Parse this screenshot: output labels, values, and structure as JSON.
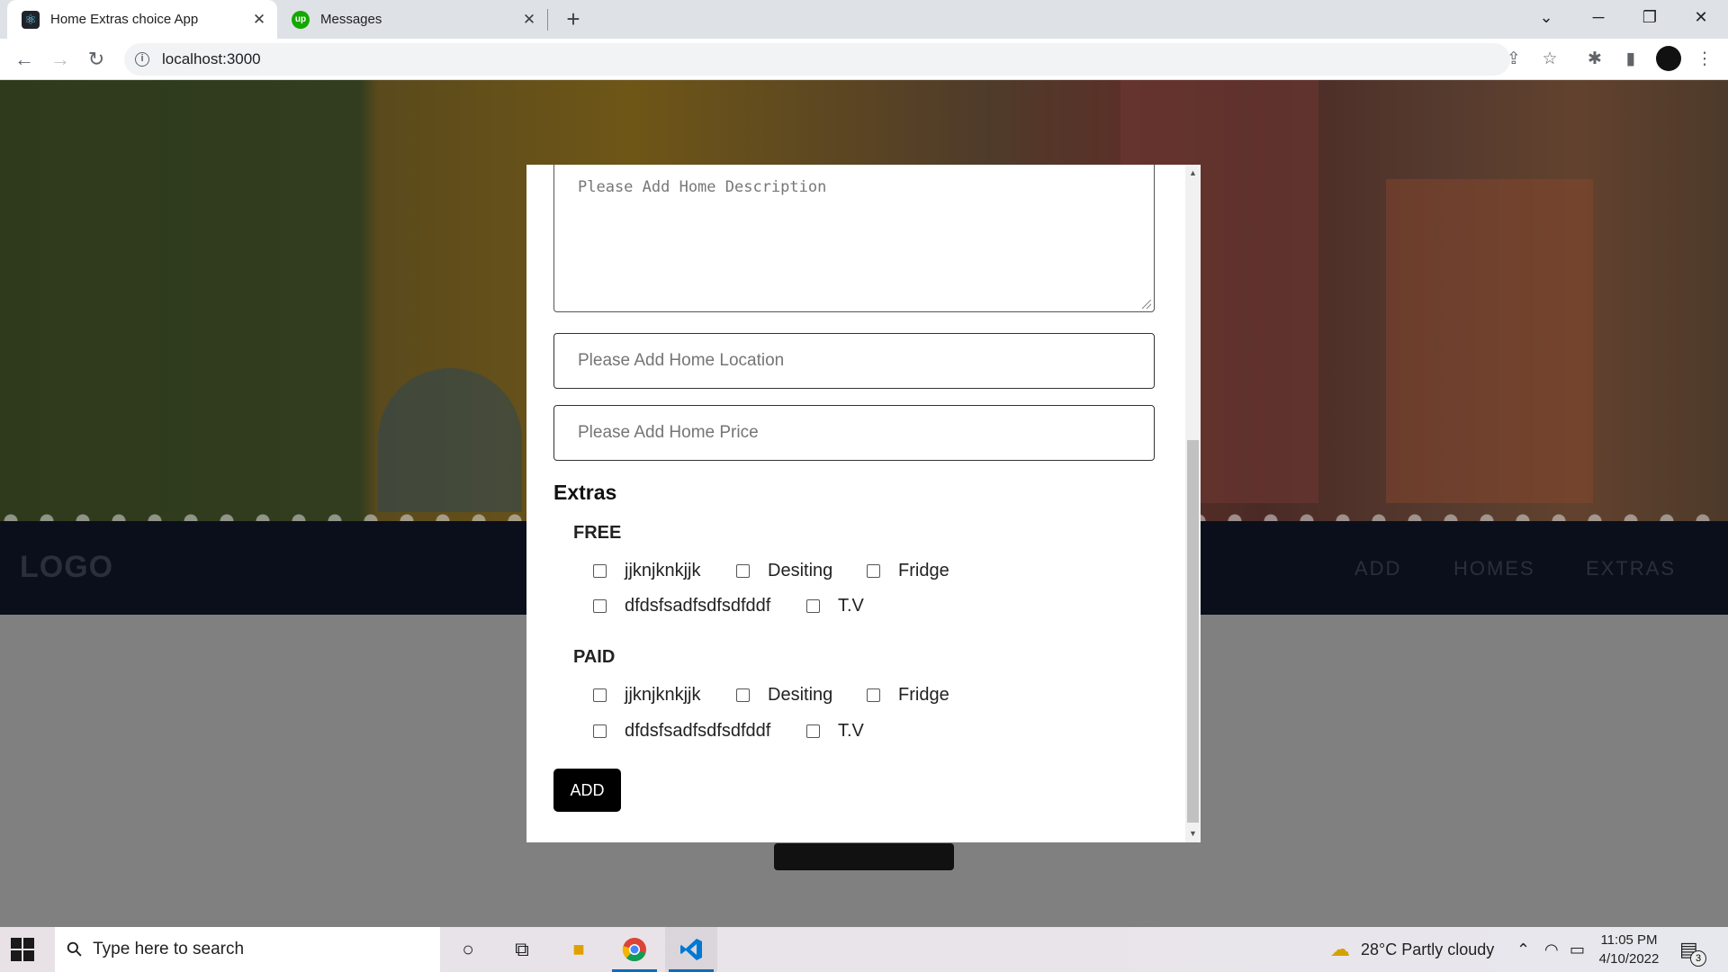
{
  "browser": {
    "tabs": [
      {
        "title": "Home Extras choice App",
        "active": true
      },
      {
        "title": "Messages",
        "active": false
      }
    ],
    "url": "localhost:3000",
    "icons": {
      "back": "←",
      "forward": "→",
      "reload": "↻",
      "info": "i",
      "newtab": "+",
      "tab_close": "✕",
      "tab_list": "⌄",
      "minimize": "─",
      "restore": "❐",
      "close": "✕",
      "share": "⇪",
      "bookmark": "☆",
      "extensions": "✱",
      "sidepanel": "▮",
      "menu": "⋮"
    }
  },
  "site": {
    "logo": "LOGO",
    "nav": [
      "ADD",
      "HOMES",
      "EXTRAS"
    ]
  },
  "form": {
    "description_placeholder": "Please Add Home Description",
    "location_placeholder": "Please Add Home Location",
    "price_placeholder": "Please Add Home Price",
    "extras_title": "Extras",
    "groups": [
      {
        "title": "FREE",
        "options": [
          "jjknjknkjjk",
          "Desiting",
          "Fridge",
          "dfdsfsadfsdfsdfddf",
          "T.V"
        ]
      },
      {
        "title": "PAID",
        "options": [
          "jjknjknkjjk",
          "Desiting",
          "Fridge",
          "dfdsfsadfsdfsdfddf",
          "T.V"
        ]
      }
    ],
    "submit_label": "ADD",
    "scroll_up": "▲",
    "scroll_down": "▼"
  },
  "taskbar": {
    "search_placeholder": "Type here to search",
    "weather": "28°C  Partly cloudy",
    "time": "11:05 PM",
    "date": "4/10/2022",
    "notification_count": "3",
    "icons": [
      "windows-start-icon",
      "search-icon",
      "cortana-icon",
      "task-view-icon",
      "file-explorer-icon",
      "chrome-icon",
      "vscode-icon",
      "weather-icon",
      "chevron-up-icon",
      "wifi-icon",
      "battery-icon",
      "notification-icon"
    ]
  }
}
